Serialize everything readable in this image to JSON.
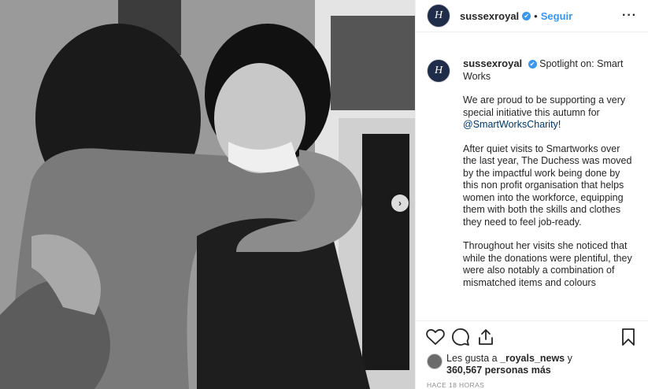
{
  "account": {
    "username": "sussexroyal",
    "avatar_letter": "H",
    "verified_mark": "✔",
    "dot": "•",
    "follow_label": "Seguir",
    "more_label": "···"
  },
  "photo": {
    "description_icon": "black-and-white-photo",
    "next_arrow": "›"
  },
  "caption": {
    "title": "Spotlight on: Smart Works",
    "paragraphs": [
      "We are proud to be supporting a very special initiative this autumn for",
      "After quiet visits to Smartworks over the last year, The Duchess was moved by the impactful work being done by this non profit organisation that helps women into the workforce, equipping them with both the skills and clothes they need to feel job-ready.",
      "Throughout her visits she noticed that while the donations were plentiful, they were also notably a combination of mismatched items and colours"
    ],
    "mention": "@SmartWorksCharity",
    "mention_suffix": "!"
  },
  "likes": {
    "prefix": "Les gusta a",
    "name": "_royals_news",
    "conjunction": "y",
    "count": "360,567",
    "suffix": "personas más"
  },
  "timestamp": "HACE 18 HORAS",
  "colors": {
    "link_blue": "#3897f0",
    "text": "#262626",
    "muted": "#8e8e8e",
    "avatar_bg": "#1f2d4a"
  }
}
